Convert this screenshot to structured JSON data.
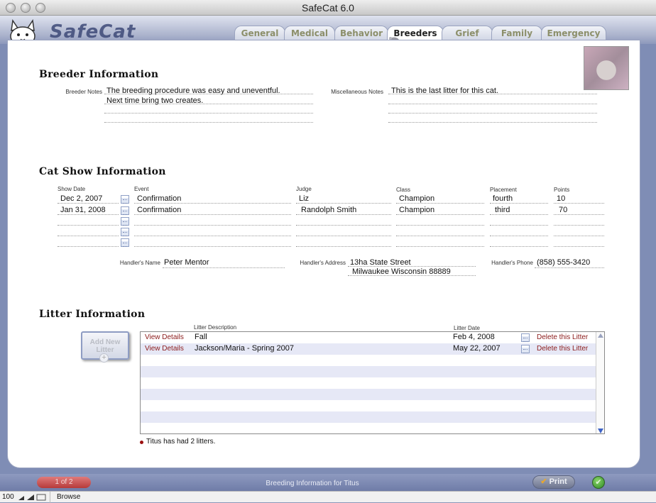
{
  "window": {
    "title": "SafeCat 6.0"
  },
  "app": {
    "logo_text": "SafeCat"
  },
  "tabs": [
    {
      "label": "General",
      "active": false
    },
    {
      "label": "Medical",
      "active": false
    },
    {
      "label": "Behavior",
      "active": false
    },
    {
      "label": "Breeders",
      "active": true
    },
    {
      "label": "Grief",
      "active": false
    },
    {
      "label": "Family",
      "active": false
    },
    {
      "label": "Emergency",
      "active": false
    }
  ],
  "breeder_info": {
    "title": "Breeder Information",
    "notes_label": "Breeder Notes",
    "notes_lines": [
      "The breeding procedure was easy and uneventful.",
      "Next time bring two creates."
    ],
    "misc_label": "Miscellaneous Notes",
    "misc_lines": [
      "This is the last litter for this cat."
    ]
  },
  "cat_show": {
    "title": "Cat Show Information",
    "headers": {
      "date": "Show Date",
      "event": "Event",
      "judge": "Judge",
      "class": "Class",
      "placement": "Placement",
      "points": "Points"
    },
    "rows": [
      {
        "date": "Dec 2, 2007",
        "event": "Confirmation",
        "judge": "Liz",
        "class": "Champion",
        "placement": "fourth",
        "points": "10"
      },
      {
        "date": "Jan 31, 2008",
        "event": "Confirmation",
        "judge": "Randolph Smith",
        "class": "Champion",
        "placement": "third",
        "points": "70"
      }
    ],
    "handler_name_label": "Handler's Name",
    "handler_name": "Peter Mentor",
    "handler_address_label": "Handler's Address",
    "handler_address_line1": "13ha State Street",
    "handler_address_line2": "Milwaukee Wisconsin 88889",
    "handler_phone_label": "Handler's Phone",
    "handler_phone": "(858) 555-3420"
  },
  "litter_info": {
    "title": "Litter Information",
    "add_button_line1": "Add New",
    "add_button_line2": "Litter",
    "desc_header": "Litter Description",
    "date_header": "Litter Date",
    "rows": [
      {
        "details_link": "View Details",
        "description": "Fall",
        "date": "Feb 4, 2008",
        "delete_link": "Delete this Litter"
      },
      {
        "details_link": "View Details",
        "description": "Jackson/Maria - Spring 2007",
        "date": "May 22, 2007",
        "delete_link": "Delete this Litter"
      }
    ],
    "summary": "Titus has had 2 litters."
  },
  "footer": {
    "pager": "1 of 2",
    "caption": "Breeding Information for Titus",
    "print_label": "Print"
  },
  "status_bar": {
    "zoom": "100",
    "mode": "Browse"
  },
  "colors": {
    "accent": "#7f8db5",
    "link_red": "#8b1a1a",
    "row_alt": "#e6e8f6"
  },
  "icons": [
    "cat-logo-icon",
    "calendar-icon",
    "mouse-icon",
    "checkmark-icon",
    "plus-icon",
    "scroll-down-arrow-icon"
  ]
}
